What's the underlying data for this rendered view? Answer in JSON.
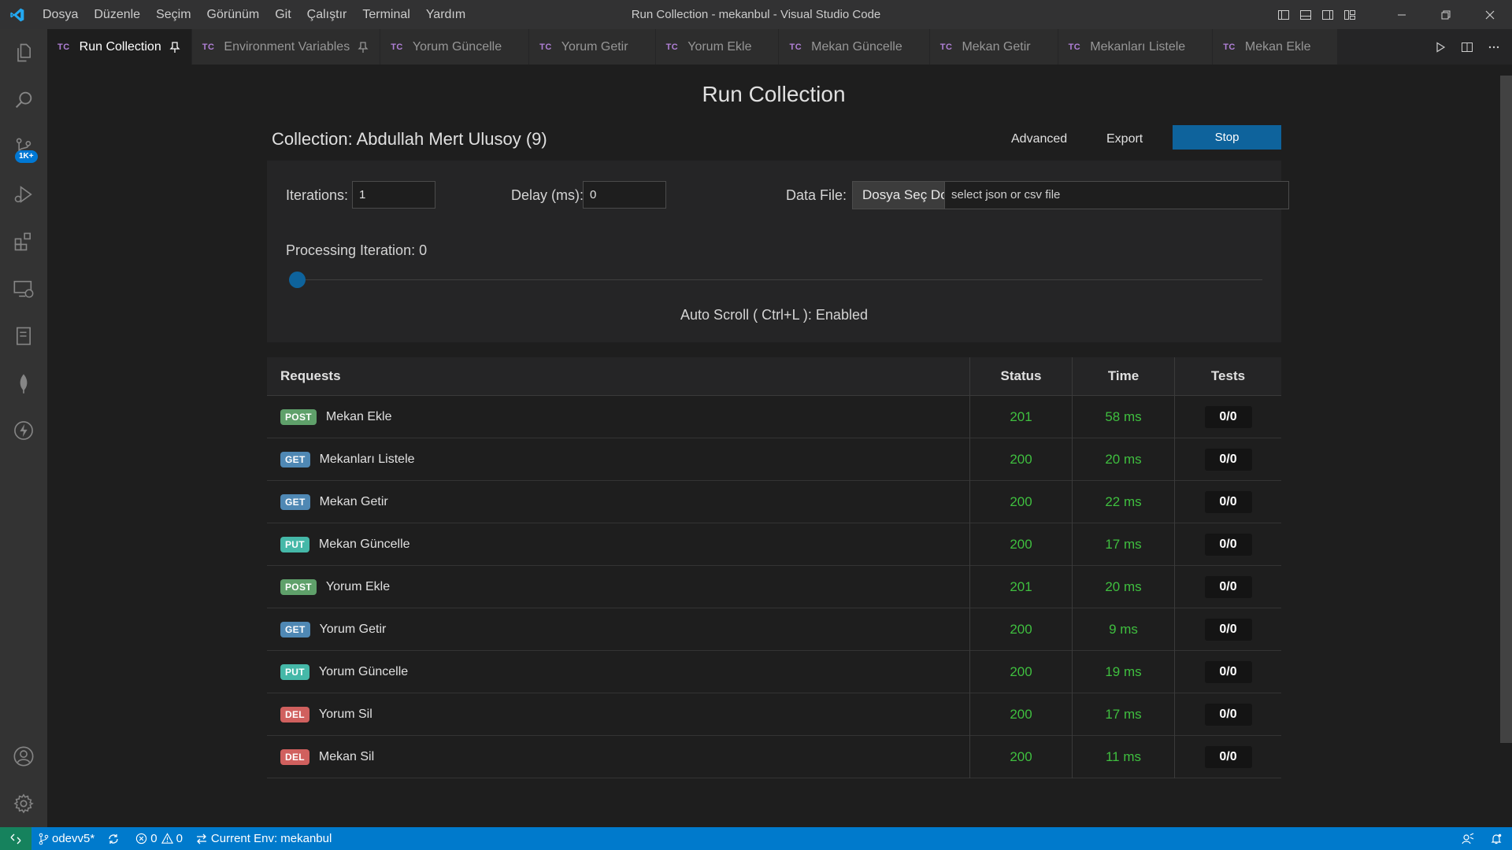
{
  "window": {
    "title": "Run Collection - mekanbul - Visual Studio Code",
    "menu": [
      "Dosya",
      "Düzenle",
      "Seçim",
      "Görünüm",
      "Git",
      "Çalıştır",
      "Terminal",
      "Yardım"
    ]
  },
  "activity_bar": {
    "icons": [
      "explorer-icon",
      "search-icon",
      "source-control-icon",
      "run-debug-icon",
      "extensions-icon",
      "remote-explorer-icon",
      "notebook-icon",
      "mongodb-leaf-icon",
      "thunder-client-icon"
    ],
    "source_control_badge": "1K+",
    "bottom_icons": [
      "account-icon",
      "settings-gear-icon"
    ]
  },
  "tabs": [
    {
      "prefix": "TC",
      "label": "Run Collection",
      "active": true,
      "pinned": true
    },
    {
      "prefix": "TC",
      "label": "Environment Variables",
      "active": false,
      "pinned": true
    },
    {
      "prefix": "TC",
      "label": "Yorum Güncelle",
      "active": false,
      "pinned": false
    },
    {
      "prefix": "TC",
      "label": "Yorum Getir",
      "active": false,
      "pinned": false
    },
    {
      "prefix": "TC",
      "label": "Yorum Ekle",
      "active": false,
      "pinned": false
    },
    {
      "prefix": "TC",
      "label": "Mekan Güncelle",
      "active": false,
      "pinned": false
    },
    {
      "prefix": "TC",
      "label": "Mekan Getir",
      "active": false,
      "pinned": false
    },
    {
      "prefix": "TC",
      "label": "Mekanları Listele",
      "active": false,
      "pinned": false
    },
    {
      "prefix": "TC",
      "label": "Mekan Ekle",
      "active": false,
      "pinned": false
    }
  ],
  "runner": {
    "title": "Run Collection",
    "collection_label": "Collection: Abdullah Mert Ulusoy (9)",
    "advanced_label": "Advanced",
    "export_label": "Export",
    "stop_label": "Stop",
    "iterations_label": "Iterations:",
    "iterations_value": "1",
    "delay_label": "Delay (ms):",
    "delay_value": "0",
    "data_file_label": "Data File:",
    "file_button_label": "Dosya Seç  Dosya seçilmedi",
    "file_placeholder": "select json or csv file",
    "processing_label": "Processing Iteration: 0",
    "progress": 0,
    "autoscroll_label": "Auto Scroll ( Ctrl+L ): Enabled"
  },
  "table": {
    "headers": {
      "requests": "Requests",
      "status": "Status",
      "time": "Time",
      "tests": "Tests"
    },
    "rows": [
      {
        "method": "POST",
        "name": "Mekan Ekle",
        "status": "201",
        "time": "58 ms",
        "tests": "0/0"
      },
      {
        "method": "GET",
        "name": "Mekanları Listele",
        "status": "200",
        "time": "20 ms",
        "tests": "0/0"
      },
      {
        "method": "GET",
        "name": "Mekan Getir",
        "status": "200",
        "time": "22 ms",
        "tests": "0/0"
      },
      {
        "method": "PUT",
        "name": "Mekan Güncelle",
        "status": "200",
        "time": "17 ms",
        "tests": "0/0"
      },
      {
        "method": "POST",
        "name": "Yorum Ekle",
        "status": "201",
        "time": "20 ms",
        "tests": "0/0"
      },
      {
        "method": "GET",
        "name": "Yorum Getir",
        "status": "200",
        "time": "9 ms",
        "tests": "0/0"
      },
      {
        "method": "PUT",
        "name": "Yorum Güncelle",
        "status": "200",
        "time": "19 ms",
        "tests": "0/0"
      },
      {
        "method": "DEL",
        "name": "Yorum Sil",
        "status": "200",
        "time": "17 ms",
        "tests": "0/0"
      },
      {
        "method": "DEL",
        "name": "Mekan Sil",
        "status": "200",
        "time": "11 ms",
        "tests": "0/0"
      }
    ]
  },
  "status_bar": {
    "branch": "odevv5*",
    "errors": "0",
    "warnings": "0",
    "env": "Current Env: mekanbul"
  },
  "colors": {
    "accent": "#007acc",
    "stop_button": "#0e639c",
    "success_text": "#3fbf3f",
    "method_post": "#5fa06a",
    "method_get": "#4f88b4",
    "method_put": "#45b8a8",
    "method_del": "#d0605e"
  }
}
